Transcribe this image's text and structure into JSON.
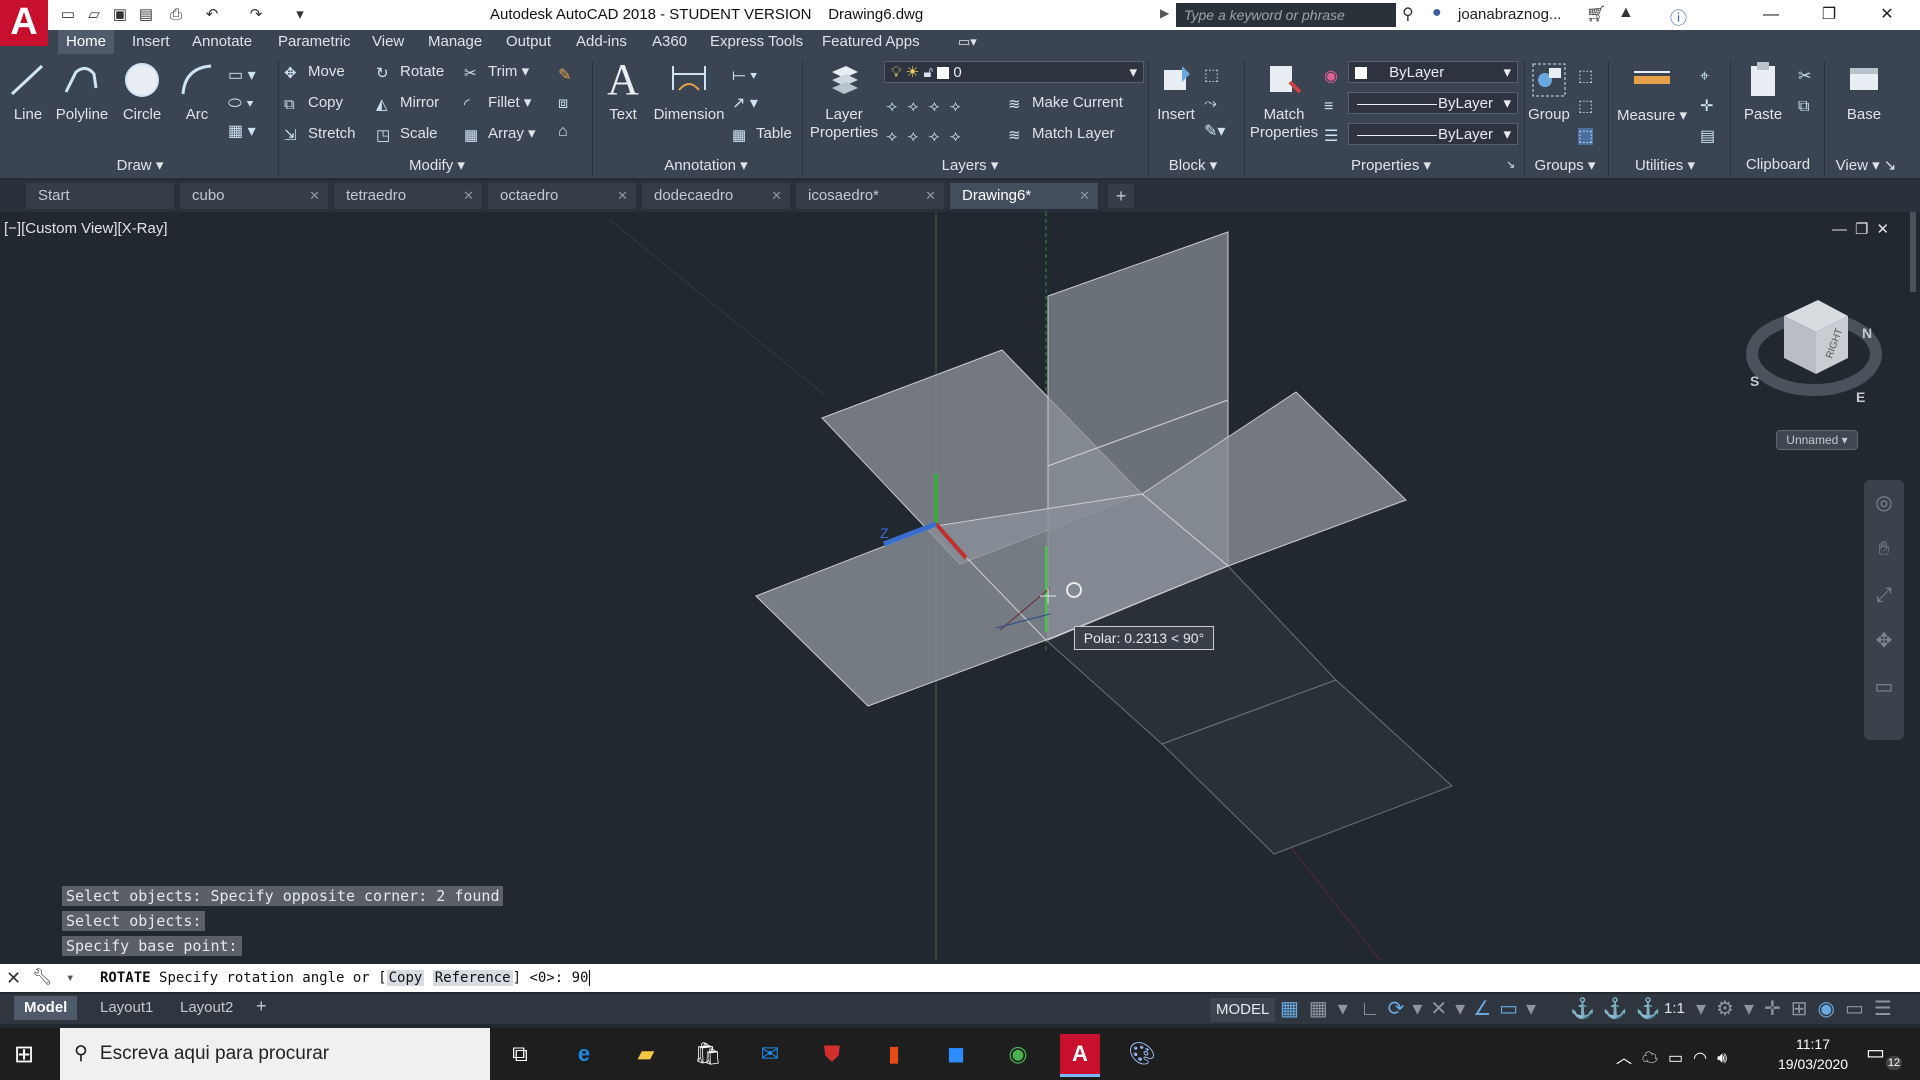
{
  "titlebar": {
    "title": "Autodesk AutoCAD 2018 - STUDENT VERSION    Drawing6.dwg",
    "search_placeholder": "Type a keyword or phrase",
    "user": "joanabraznog..."
  },
  "menu_tabs": [
    "Home",
    "Insert",
    "Annotate",
    "Parametric",
    "View",
    "Manage",
    "Output",
    "Add-ins",
    "A360",
    "Express Tools",
    "Featured Apps"
  ],
  "ribbon": {
    "draw": {
      "title": "Draw",
      "line": "Line",
      "polyline": "Polyline",
      "circle": "Circle",
      "arc": "Arc"
    },
    "modify": {
      "title": "Modify",
      "move": "Move",
      "rotate": "Rotate",
      "trim": "Trim",
      "copy": "Copy",
      "mirror": "Mirror",
      "fillet": "Fillet",
      "stretch": "Stretch",
      "scale": "Scale",
      "array": "Array"
    },
    "annotation": {
      "title": "Annotation",
      "text": "Text",
      "dimension": "Dimension",
      "table": "Table"
    },
    "layers": {
      "title": "Layers",
      "layer_properties": "Layer Properties",
      "current_layer": "0",
      "make_current": "Make Current",
      "match_layer": "Match Layer"
    },
    "block": {
      "title": "Block",
      "insert": "Insert"
    },
    "properties": {
      "title": "Properties",
      "match_properties": "Match Properties",
      "color": "ByLayer",
      "linetype": "ByLayer",
      "lineweight": "ByLayer"
    },
    "groups": {
      "title": "Groups",
      "group": "Group"
    },
    "utilities": {
      "title": "Utilities",
      "measure": "Measure"
    },
    "clipboard": {
      "title": "Clipboard",
      "paste": "Paste"
    },
    "view": {
      "title": "View",
      "base": "Base"
    }
  },
  "file_tabs": [
    {
      "label": "Start"
    },
    {
      "label": "cubo"
    },
    {
      "label": "tetraedro"
    },
    {
      "label": "octaedro"
    },
    {
      "label": "dodecaedro"
    },
    {
      "label": "icosaedro*"
    },
    {
      "label": "Drawing6*"
    }
  ],
  "viewport": {
    "label": "[−][Custom View][X-Ray]",
    "viewcube_named": "Unnamed",
    "viewcube_face": "RIGHT",
    "compass": {
      "n": "N",
      "s": "S",
      "e": "E"
    },
    "polar_tooltip": "Polar: 0.2313 < 90°"
  },
  "command_history": [
    "Select objects: Specify opposite corner: 2 found",
    "Select objects:",
    "Specify base point:"
  ],
  "command_line": {
    "command": "ROTATE",
    "prompt": "Specify rotation angle or [",
    "opt1": "Copy",
    "opt2": "Reference",
    "suffix": "] <0>:",
    "value": "90"
  },
  "layout_tabs": [
    "Model",
    "Layout1",
    "Layout2"
  ],
  "status": {
    "model": "MODEL",
    "scale": "1:1"
  },
  "taskbar": {
    "search_placeholder": "Escreva aqui para procurar",
    "time": "11:17",
    "date": "19/03/2020",
    "notifications": "12"
  }
}
